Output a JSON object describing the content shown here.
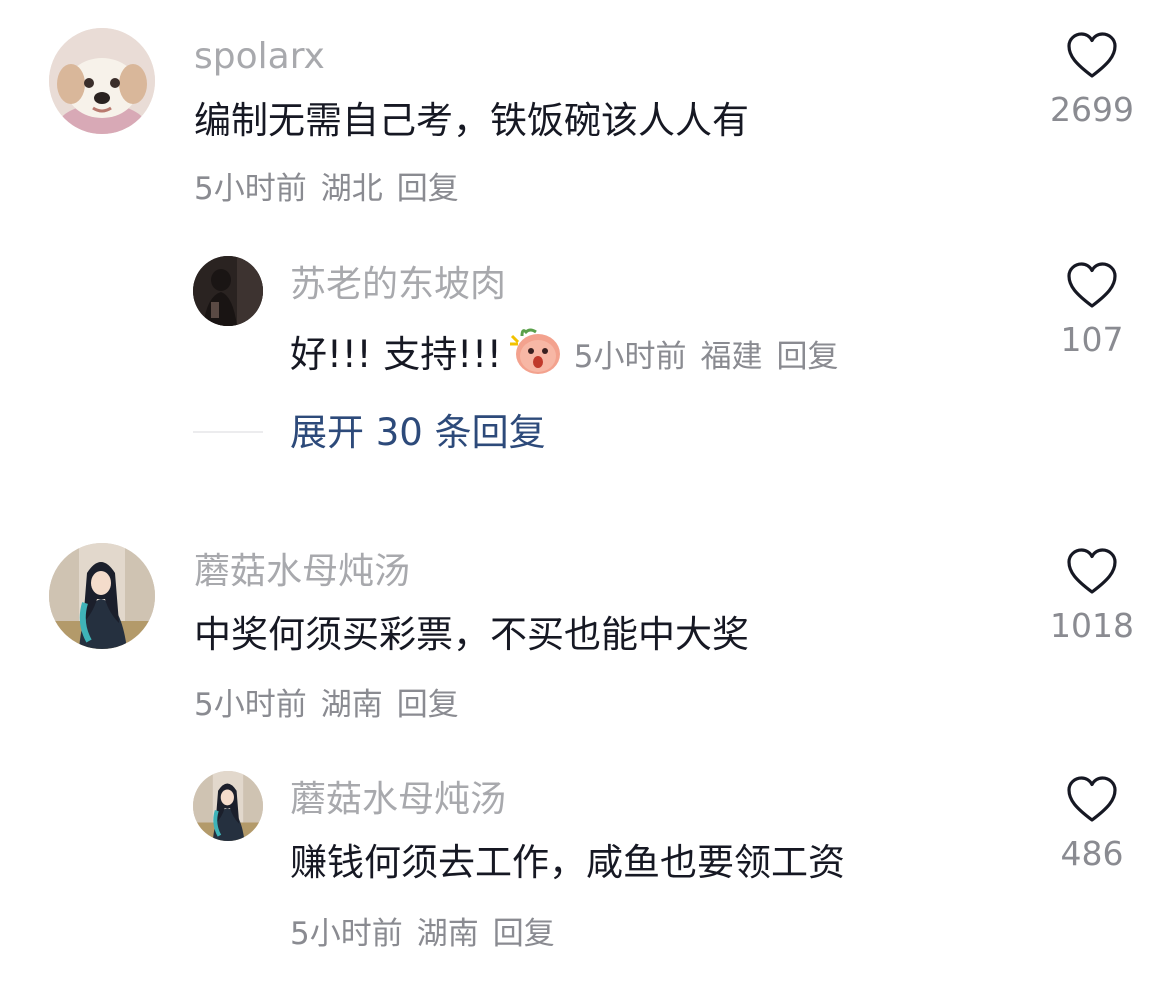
{
  "comments": [
    {
      "username": "spolarx",
      "text": "编制无需自己考，铁饭碗该人人有",
      "time": "5小时前",
      "location": "湖北",
      "reply_label": "回复",
      "likes": "2699",
      "avatar": "dog-avatar",
      "reply": {
        "username": "苏老的东坡肉",
        "text": "好!!! 支持!!!",
        "emoji": "angry-peach-emoji",
        "time": "5小时前",
        "location": "福建",
        "reply_label": "回复",
        "likes": "107",
        "avatar": "dark-figure-avatar"
      },
      "expand_label": "展开 30 条回复"
    },
    {
      "username": "蘑菇水母炖汤",
      "text": "中奖何须买彩票，不买也能中大奖",
      "time": "5小时前",
      "location": "湖南",
      "reply_label": "回复",
      "likes": "1018",
      "avatar": "anime-character-avatar",
      "reply": {
        "username": "蘑菇水母炖汤",
        "text": "赚钱何须去工作，咸鱼也要领工资",
        "time": "5小时前",
        "location": "湖南",
        "reply_label": "回复",
        "likes": "486",
        "avatar": "anime-character-avatar"
      }
    }
  ],
  "colors": {
    "username": "#a8a9ad",
    "content": "#161823",
    "meta": "#8a8b91",
    "expand": "#2d4a7a",
    "heart_stroke": "#161823"
  },
  "icons": {
    "like": "heart-outline-icon"
  }
}
